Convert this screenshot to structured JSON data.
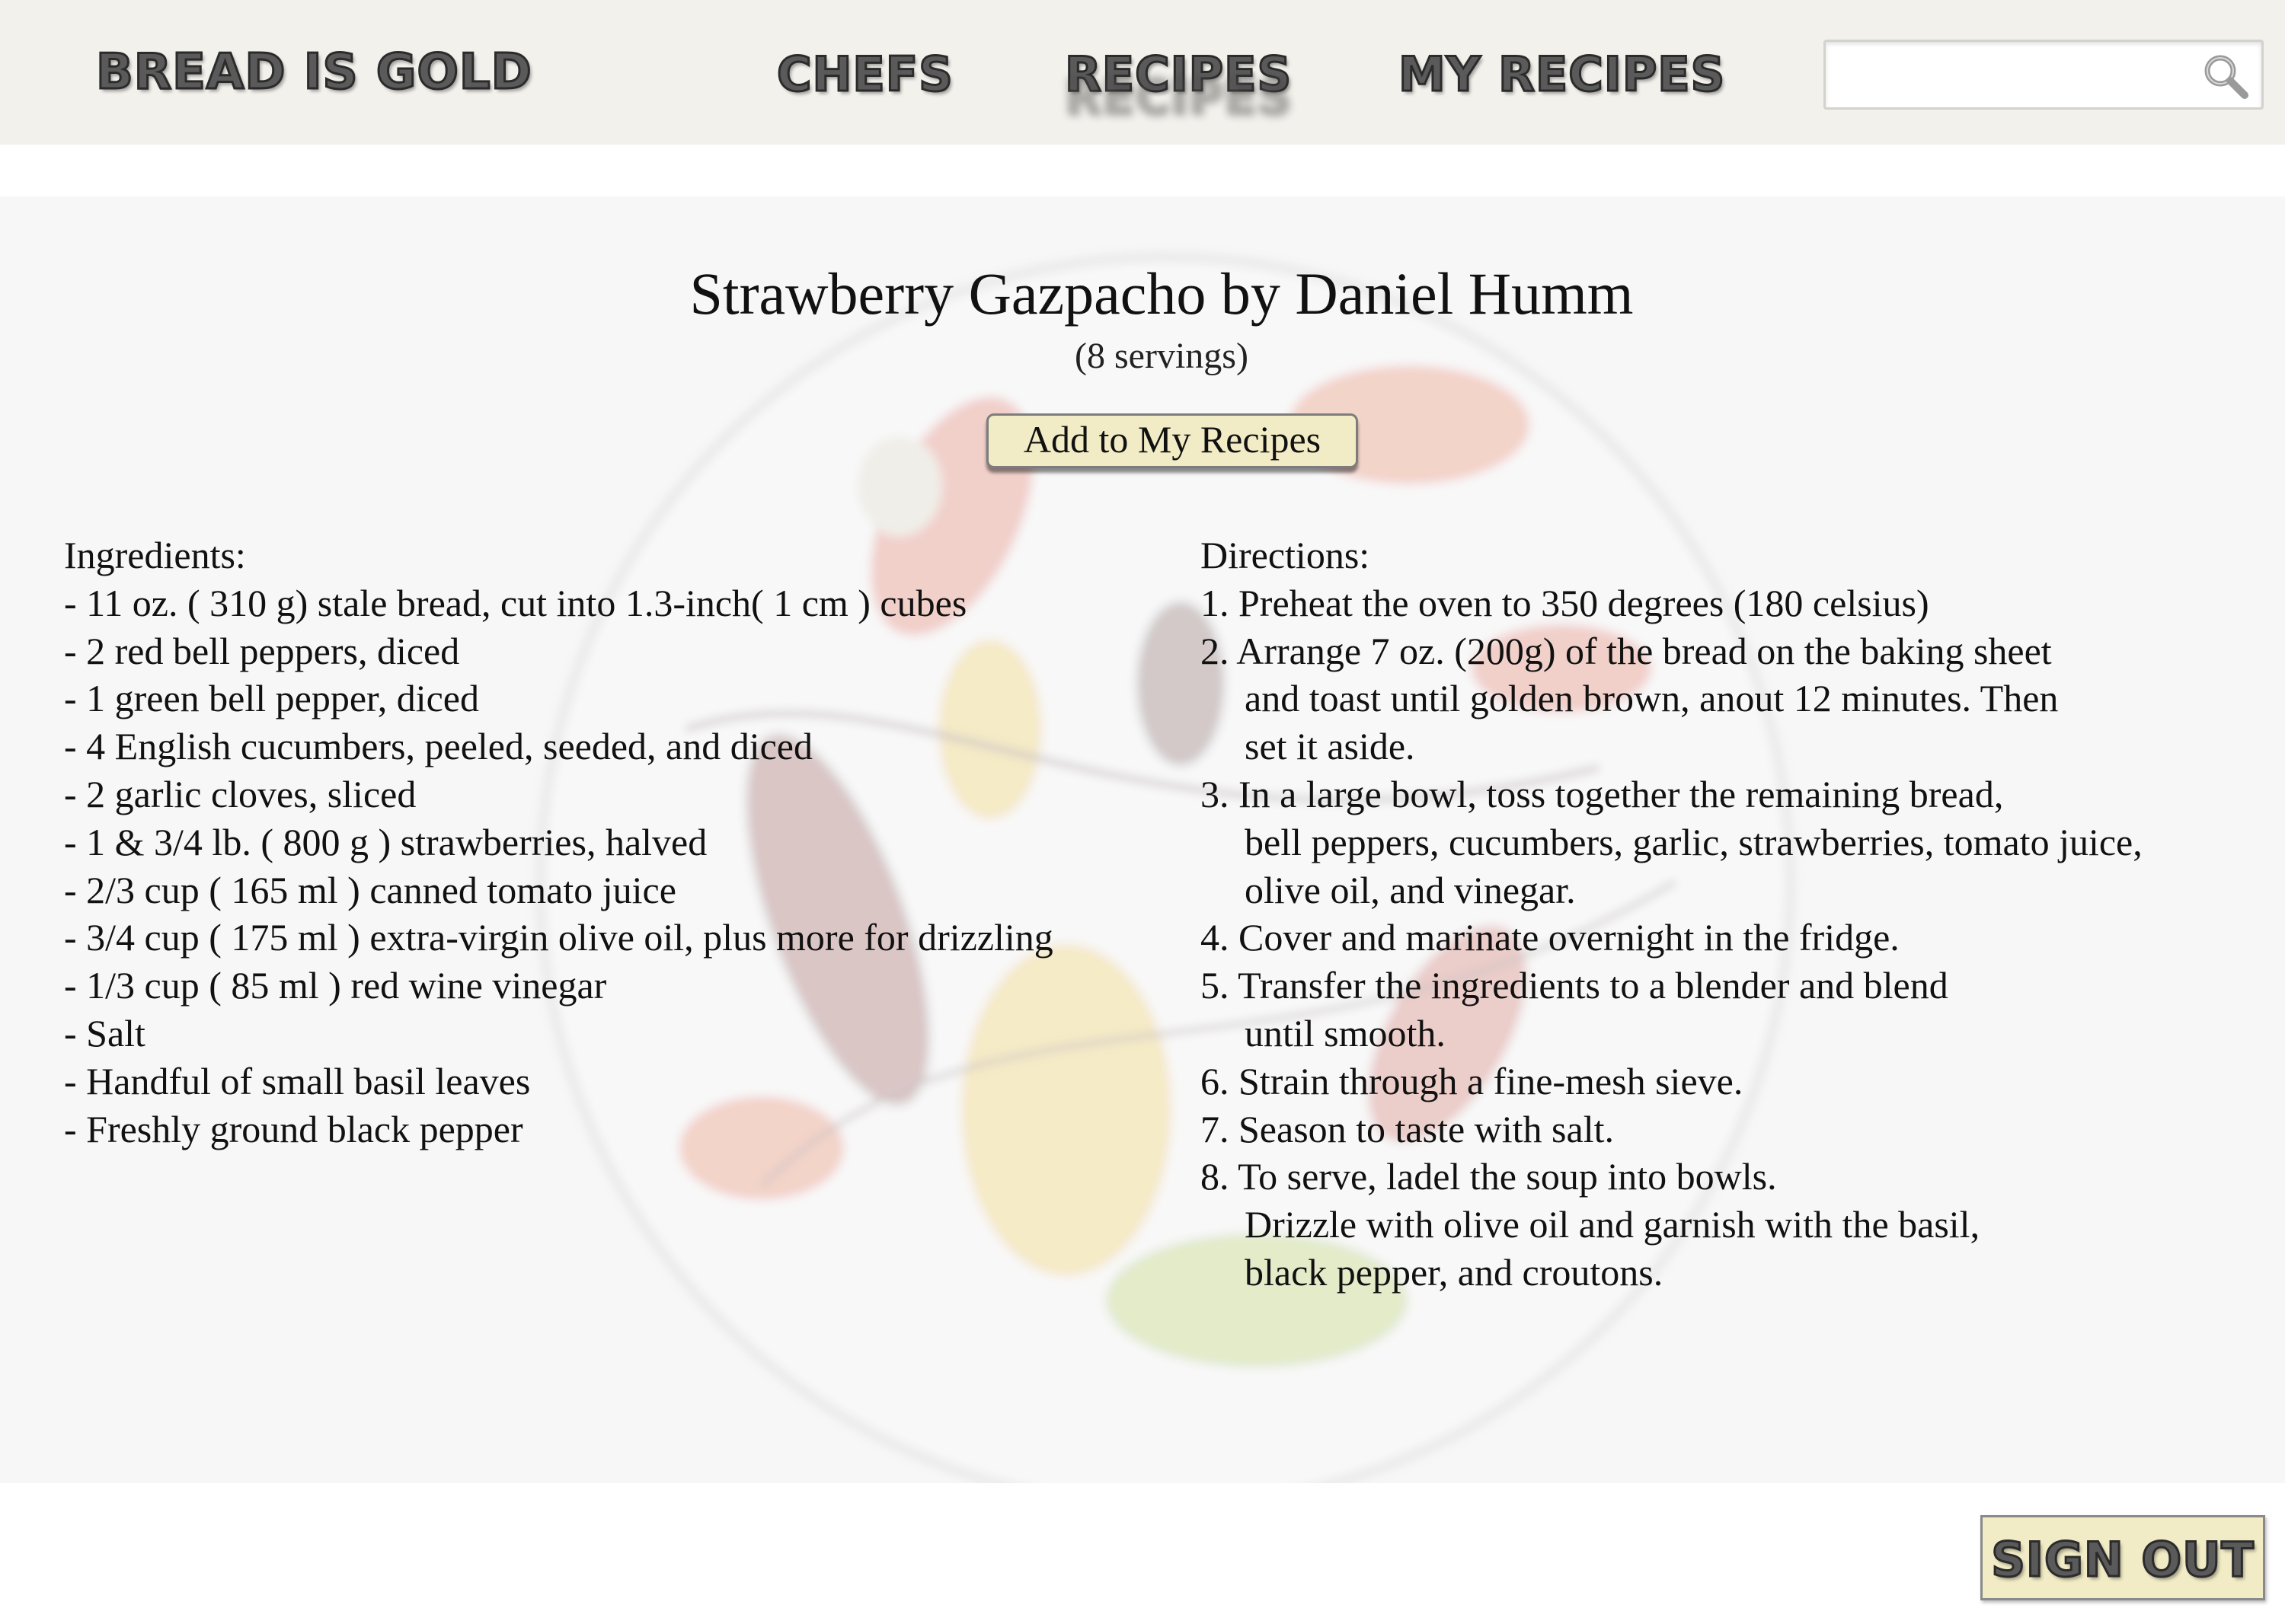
{
  "header": {
    "brand": "BREAD IS GOLD",
    "nav": [
      "CHEFS",
      "RECIPES",
      "MY RECIPES"
    ],
    "search": {
      "placeholder": "",
      "icon": "search-icon"
    }
  },
  "recipe": {
    "title": "Strawberry Gazpacho by Daniel Humm",
    "servings": "(8 servings)",
    "add_button": "Add to My Recipes",
    "ingredients_heading": "Ingredients:",
    "ingredients": [
      "- 11 oz. ( 310 g) stale bread, cut into 1.3-inch( 1 cm ) cubes",
      "- 2 red bell peppers, diced",
      "- 1 green bell pepper, diced",
      "- 4 English cucumbers, peeled, seeded, and diced",
      "- 2 garlic cloves, sliced",
      "- 1 & 3/4 lb. ( 800 g ) strawberries, halved",
      "- 2/3 cup ( 165 ml ) canned tomato juice",
      "- 3/4 cup ( 175 ml ) extra-virgin olive oil, plus more for drizzling",
      "- 1/3 cup ( 85 ml ) red wine vinegar",
      "- Salt",
      "- Handful of small basil leaves",
      "- Freshly ground black pepper"
    ],
    "directions_heading": "Directions:",
    "directions": [
      "1. Preheat the oven to 350 degrees (180 celsius)",
      "2. Arrange 7 oz. (200g) of the bread on the baking sheet",
      "and toast until golden brown, anout 12 minutes. Then",
      "set it aside.",
      "3. In a large bowl, toss together the remaining bread,",
      "bell peppers, cucumbers, garlic, strawberries, tomato juice,",
      "olive oil, and vinegar.",
      "4. Cover and marinate overnight in the fridge.",
      "5. Transfer the ingredients to a blender and blend",
      "until smooth.",
      "6. Strain through a fine-mesh sieve.",
      "7. Season to taste with salt.",
      "8. To serve, ladel the soup into bowls.",
      "Drizzle with olive oil and garnish with the basil,",
      "black pepper, and croutons."
    ]
  },
  "footer": {
    "sign_out": "SIGN OUT"
  },
  "colors": {
    "header_bg": "#f3f1ec",
    "button_bg": "#f2ecc6",
    "nav_text": "#5a5a5a"
  }
}
